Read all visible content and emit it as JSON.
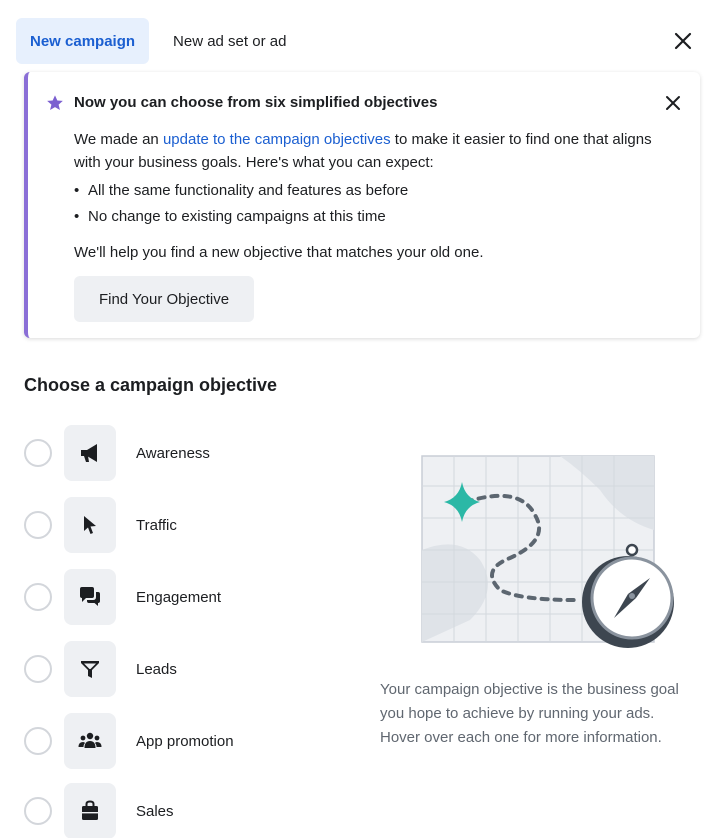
{
  "tabs": [
    {
      "label": "New campaign",
      "active": true
    },
    {
      "label": "New ad set or ad",
      "active": false
    }
  ],
  "banner": {
    "title": "Now you can choose from six simplified objectives",
    "body_before_link": "We made an ",
    "link_text": "update to the campaign objectives",
    "body_after_link": " to make it easier to find one that aligns with your business goals. Here's what you can expect:",
    "bullets": [
      "All the same functionality and features as before",
      "No change to existing campaigns at this time"
    ],
    "note": "We'll help you find a new objective that matches your old one.",
    "button_label": "Find Your Objective"
  },
  "objectives_title": "Choose a campaign objective",
  "objectives": [
    {
      "label": "Awareness",
      "icon": "megaphone-icon"
    },
    {
      "label": "Traffic",
      "icon": "cursor-icon"
    },
    {
      "label": "Engagement",
      "icon": "chat-bubbles-icon"
    },
    {
      "label": "Leads",
      "icon": "funnel-icon"
    },
    {
      "label": "App promotion",
      "icon": "people-icon"
    },
    {
      "label": "Sales",
      "icon": "shopping-bag-icon"
    }
  ],
  "description": "Your campaign objective is the business goal you hope to achieve by running your ads. Hover over each one for more information.",
  "colors": {
    "accent": "#1b5fd1",
    "banner_border": "#8a6ed6",
    "teal": "#2bb8a6"
  }
}
